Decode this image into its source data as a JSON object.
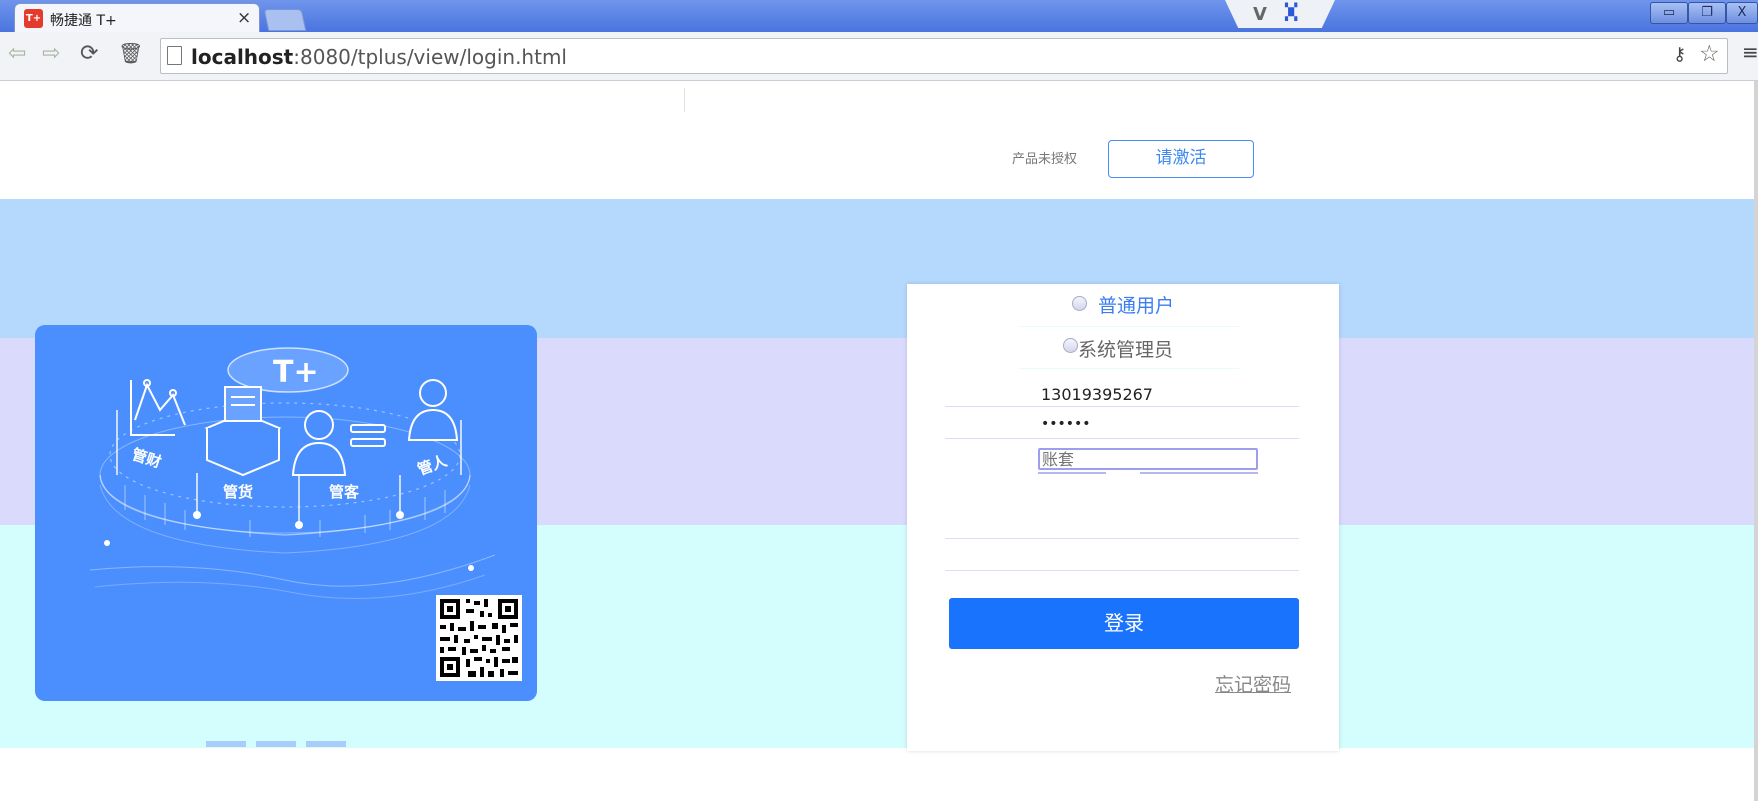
{
  "browser": {
    "tab_title": "畅捷通 T+",
    "tab_favicon_text": "T+",
    "tab_close": "×",
    "url_host": "localhost",
    "url_rest": ":8080/tplus/view/login.html",
    "window_buttons": [
      "▭",
      "❐",
      "X"
    ]
  },
  "header": {
    "auth_status": "产品未授权",
    "activate_label": "请激活"
  },
  "promo": {
    "logo_text": "T+",
    "features": [
      "管财",
      "管货",
      "管客",
      "管人"
    ]
  },
  "login": {
    "roles": [
      {
        "label": "普通用户",
        "selected": false
      },
      {
        "label": "系统管理员",
        "selected": false
      }
    ],
    "username_value": "13019395267",
    "password_value": "••••••",
    "account_placeholder": "账套",
    "login_label": "登录",
    "forgot_label": "忘记密码"
  },
  "colors": {
    "band_top": "#b5d8fd",
    "band_mid": "#dadafd",
    "band_bottom": "#d4fdfd",
    "promo_bg": "#4b8ffe",
    "login_button": "#1a73fc",
    "accent_blue": "#3c7df1"
  }
}
